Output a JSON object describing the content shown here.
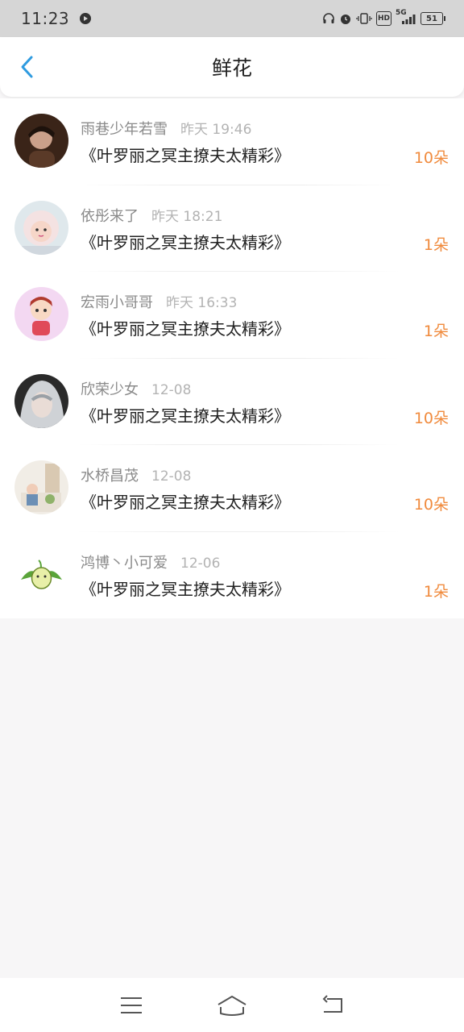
{
  "status_bar": {
    "time": "11:23",
    "network": "5G",
    "battery": "51",
    "hd": "HD"
  },
  "header": {
    "title": "鲜花"
  },
  "colors": {
    "accent_blue": "#2f9be0",
    "count_orange": "#f08a3c"
  },
  "items": [
    {
      "name": "雨巷少年若雪",
      "time": "昨天 19:46",
      "book": "《叶罗丽之冥主撩夫太精彩》",
      "count": "10朵",
      "avatar": "avatar-portrait-man"
    },
    {
      "name": "依彤来了",
      "time": "昨天 18:21",
      "book": "《叶罗丽之冥主撩夫太精彩》",
      "count": "1朵",
      "avatar": "avatar-baby-hood"
    },
    {
      "name": "宏雨小哥哥",
      "time": "昨天 16:33",
      "book": "《叶罗丽之冥主撩夫太精彩》",
      "count": "1朵",
      "avatar": "avatar-cartoon-boy"
    },
    {
      "name": "欣荣少女",
      "time": "12-08",
      "book": "《叶罗丽之冥主撩夫太精彩》",
      "count": "10朵",
      "avatar": "avatar-girl-portrait"
    },
    {
      "name": "水桥昌茂",
      "time": "12-08",
      "book": "《叶罗丽之冥主撩夫太精彩》",
      "count": "10朵",
      "avatar": "avatar-room-scene"
    },
    {
      "name": "鸿博丶小可爱",
      "time": "12-06",
      "book": "《叶罗丽之冥主撩夫太精彩》",
      "count": "1朵",
      "avatar": "avatar-sprout"
    }
  ]
}
